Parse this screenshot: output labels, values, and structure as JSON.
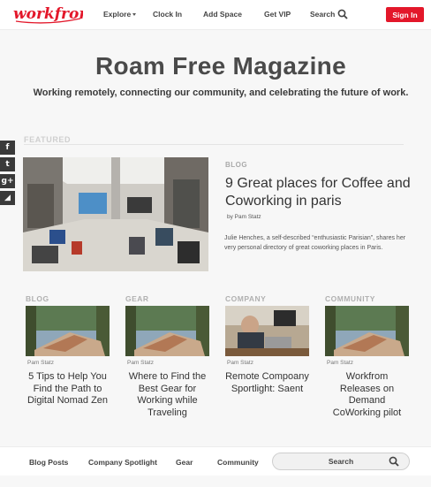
{
  "header": {
    "logo_text": "workfrom",
    "nav": [
      {
        "label": "Explore"
      },
      {
        "label": "Clock In"
      },
      {
        "label": "Add Space"
      },
      {
        "label": "Get VIP"
      },
      {
        "label": "Search"
      }
    ],
    "signin_label": "Sign In"
  },
  "hero": {
    "title": "Roam Free Magazine",
    "subtitle": "Working remotely, connecting our community, and celebrating the future of work."
  },
  "social_icons": [
    "facebook-icon",
    "twitter-icon",
    "google-plus-icon",
    "rss-icon"
  ],
  "social_glyphs": {
    "facebook": "f",
    "twitter": "t",
    "google_plus": "g+",
    "rss": "◢"
  },
  "featured": {
    "label": "FEATURED",
    "category": "BLOG",
    "title": "9 Great places for Coffee and Coworking in paris",
    "author": "by Pam Statz",
    "excerpt": "Julie Henches, a self-described “enthusiastic Parisian”, shares her very personal directory of great coworking places in Paris."
  },
  "cards": [
    {
      "category": "BLOG",
      "author": "Pam Statz",
      "title": "5 Tips to Help You Find the Path to Digital Nomad Zen"
    },
    {
      "category": "GEAR",
      "author": "Pam Statz",
      "title": "Where to Find the Best Gear for Working while Traveling"
    },
    {
      "category": "COMPANY",
      "author": "Pam Statz",
      "title": "Remote Compoany Sportlight: Saent"
    },
    {
      "category": "COMMUNITY",
      "author": "Pam Statz",
      "title": "Workfrom Releases on Demand CoWorking pilot"
    }
  ],
  "footer": {
    "links": [
      {
        "label": "Blog Posts"
      },
      {
        "label": "Company Spotlight"
      },
      {
        "label": "Gear"
      },
      {
        "label": "Community"
      }
    ],
    "search_placeholder": "Search"
  },
  "colors": {
    "brand_red": "#e3172a",
    "text_dark": "#333333",
    "category_grey": "#b0b0b0",
    "social_bg": "#3a3a3a"
  }
}
